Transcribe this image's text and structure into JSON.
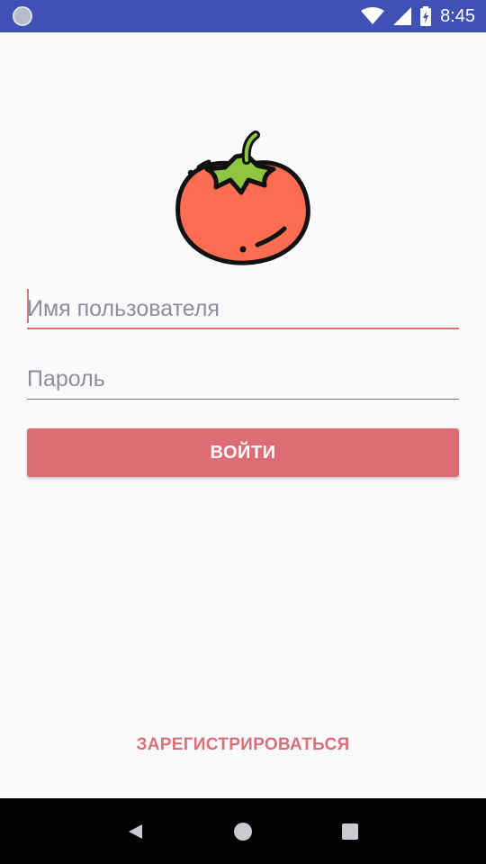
{
  "status_bar": {
    "time": "8:45",
    "icons": [
      "notification-dot-icon",
      "wifi-icon",
      "signal-icon",
      "battery-icon"
    ]
  },
  "login": {
    "username_placeholder": "Имя пользователя",
    "password_placeholder": "Пароль",
    "login_button_label": "ВОЙТИ",
    "register_label": "ЗАРЕГИСТРИРОВАТЬСЯ",
    "logo_icon": "tomato-icon"
  },
  "nav_bar": {
    "icons": [
      "back-icon",
      "home-icon",
      "recents-icon"
    ]
  },
  "colors": {
    "status_bar": "#3f51b5",
    "accent": "#de6c74",
    "background": "#fbfbfd",
    "nav_bar": "#000000"
  }
}
